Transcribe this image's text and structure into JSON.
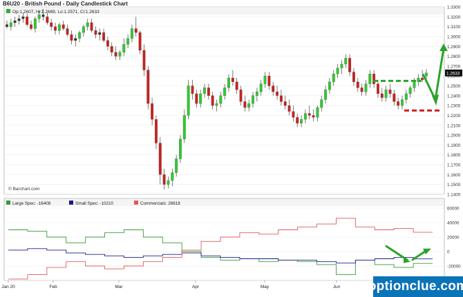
{
  "title": "B6U20 - British Pound - Daily Candlestick Chart",
  "ohlc_label": "Op:1.2607, Hi:1.2669, Lo:1.2571, Cl:1.2633",
  "last_price": "1.2633",
  "copyright": "© Barchart.com",
  "brand": "optionclue.com",
  "colors": {
    "up": "#2ecc2e",
    "down": "#cc1f1f",
    "large_spec": "#3a9a3a",
    "small_spec": "#1a1a8c",
    "commercials": "#e25a5a",
    "annotation_green": "#29a329",
    "annotation_red": "#cc2020"
  },
  "chart_data": [
    {
      "type": "candlestick",
      "title": "B6U20 - British Pound - Daily Candlestick Chart",
      "ylim": [
        1.14,
        1.33
      ],
      "yticks": [
        1.14,
        1.15,
        1.16,
        1.17,
        1.18,
        1.19,
        1.2,
        1.21,
        1.22,
        1.23,
        1.24,
        1.25,
        1.26,
        1.27,
        1.28,
        1.29,
        1.3,
        1.31,
        1.32,
        1.33
      ],
      "x_labels": [
        "Jan 20",
        "Feb",
        "Mar",
        "Apr",
        "May",
        "Jun"
      ],
      "candles": [
        [
          1.312,
          1.316,
          1.308,
          1.31
        ],
        [
          1.31,
          1.318,
          1.306,
          1.314
        ],
        [
          1.314,
          1.32,
          1.31,
          1.316
        ],
        [
          1.316,
          1.322,
          1.312,
          1.318
        ],
        [
          1.318,
          1.324,
          1.314,
          1.32
        ],
        [
          1.32,
          1.323,
          1.31,
          1.312
        ],
        [
          1.312,
          1.316,
          1.306,
          1.308
        ],
        [
          1.308,
          1.32,
          1.304,
          1.318
        ],
        [
          1.318,
          1.326,
          1.314,
          1.322
        ],
        [
          1.322,
          1.328,
          1.316,
          1.32
        ],
        [
          1.32,
          1.324,
          1.312,
          1.314
        ],
        [
          1.314,
          1.318,
          1.306,
          1.31
        ],
        [
          1.31,
          1.314,
          1.302,
          1.306
        ],
        [
          1.306,
          1.314,
          1.302,
          1.312
        ],
        [
          1.312,
          1.316,
          1.306,
          1.308
        ],
        [
          1.308,
          1.312,
          1.3,
          1.302
        ],
        [
          1.302,
          1.306,
          1.292,
          1.296
        ],
        [
          1.296,
          1.302,
          1.29,
          1.298
        ],
        [
          1.298,
          1.306,
          1.294,
          1.304
        ],
        [
          1.304,
          1.312,
          1.3,
          1.31
        ],
        [
          1.31,
          1.318,
          1.306,
          1.314
        ],
        [
          1.314,
          1.318,
          1.304,
          1.306
        ],
        [
          1.306,
          1.31,
          1.298,
          1.302
        ],
        [
          1.302,
          1.308,
          1.296,
          1.304
        ],
        [
          1.304,
          1.308,
          1.294,
          1.296
        ],
        [
          1.296,
          1.3,
          1.286,
          1.29
        ],
        [
          1.29,
          1.294,
          1.28,
          1.284
        ],
        [
          1.284,
          1.29,
          1.276,
          1.28
        ],
        [
          1.28,
          1.286,
          1.276,
          1.284
        ],
        [
          1.284,
          1.298,
          1.28,
          1.292
        ],
        [
          1.292,
          1.302,
          1.288,
          1.298
        ],
        [
          1.298,
          1.312,
          1.294,
          1.308
        ],
        [
          1.308,
          1.32,
          1.3,
          1.304
        ],
        [
          1.304,
          1.306,
          1.282,
          1.286
        ],
        [
          1.286,
          1.292,
          1.26,
          1.266
        ],
        [
          1.266,
          1.27,
          1.226,
          1.232
        ],
        [
          1.232,
          1.238,
          1.21,
          1.216
        ],
        [
          1.216,
          1.22,
          1.186,
          1.192
        ],
        [
          1.192,
          1.198,
          1.15,
          1.16
        ],
        [
          1.16,
          1.166,
          1.145,
          1.15
        ],
        [
          1.15,
          1.158,
          1.146,
          1.154
        ],
        [
          1.154,
          1.166,
          1.148,
          1.162
        ],
        [
          1.162,
          1.18,
          1.158,
          1.176
        ],
        [
          1.176,
          1.2,
          1.172,
          1.196
        ],
        [
          1.196,
          1.226,
          1.192,
          1.22
        ],
        [
          1.22,
          1.256,
          1.216,
          1.25
        ],
        [
          1.25,
          1.256,
          1.236,
          1.242
        ],
        [
          1.242,
          1.246,
          1.228,
          1.232
        ],
        [
          1.232,
          1.246,
          1.228,
          1.242
        ],
        [
          1.242,
          1.252,
          1.238,
          1.248
        ],
        [
          1.248,
          1.252,
          1.236,
          1.24
        ],
        [
          1.24,
          1.244,
          1.226,
          1.23
        ],
        [
          1.23,
          1.236,
          1.224,
          1.232
        ],
        [
          1.232,
          1.244,
          1.228,
          1.24
        ],
        [
          1.24,
          1.252,
          1.236,
          1.248
        ],
        [
          1.248,
          1.262,
          1.244,
          1.258
        ],
        [
          1.258,
          1.266,
          1.25,
          1.254
        ],
        [
          1.254,
          1.258,
          1.242,
          1.246
        ],
        [
          1.246,
          1.25,
          1.23,
          1.234
        ],
        [
          1.234,
          1.24,
          1.224,
          1.228
        ],
        [
          1.228,
          1.236,
          1.224,
          1.232
        ],
        [
          1.232,
          1.244,
          1.228,
          1.24
        ],
        [
          1.24,
          1.248,
          1.234,
          1.244
        ],
        [
          1.244,
          1.256,
          1.24,
          1.252
        ],
        [
          1.252,
          1.264,
          1.248,
          1.26
        ],
        [
          1.26,
          1.264,
          1.246,
          1.25
        ],
        [
          1.25,
          1.254,
          1.24,
          1.244
        ],
        [
          1.244,
          1.25,
          1.236,
          1.24
        ],
        [
          1.24,
          1.246,
          1.23,
          1.234
        ],
        [
          1.234,
          1.24,
          1.226,
          1.23
        ],
        [
          1.23,
          1.236,
          1.22,
          1.224
        ],
        [
          1.224,
          1.23,
          1.214,
          1.218
        ],
        [
          1.218,
          1.222,
          1.208,
          1.212
        ],
        [
          1.212,
          1.22,
          1.208,
          1.216
        ],
        [
          1.216,
          1.226,
          1.212,
          1.222
        ],
        [
          1.222,
          1.23,
          1.216,
          1.22
        ],
        [
          1.22,
          1.226,
          1.214,
          1.218
        ],
        [
          1.218,
          1.23,
          1.214,
          1.228
        ],
        [
          1.228,
          1.24,
          1.224,
          1.236
        ],
        [
          1.236,
          1.25,
          1.232,
          1.246
        ],
        [
          1.246,
          1.258,
          1.242,
          1.254
        ],
        [
          1.254,
          1.266,
          1.25,
          1.262
        ],
        [
          1.262,
          1.272,
          1.258,
          1.268
        ],
        [
          1.268,
          1.276,
          1.262,
          1.272
        ],
        [
          1.272,
          1.282,
          1.268,
          1.278
        ],
        [
          1.278,
          1.282,
          1.26,
          1.264
        ],
        [
          1.264,
          1.268,
          1.25,
          1.254
        ],
        [
          1.254,
          1.258,
          1.244,
          1.248
        ],
        [
          1.248,
          1.252,
          1.24,
          1.244
        ],
        [
          1.244,
          1.256,
          1.24,
          1.252
        ],
        [
          1.252,
          1.266,
          1.248,
          1.262
        ],
        [
          1.262,
          1.266,
          1.248,
          1.252
        ],
        [
          1.252,
          1.256,
          1.238,
          1.242
        ],
        [
          1.242,
          1.248,
          1.234,
          1.238
        ],
        [
          1.238,
          1.25,
          1.234,
          1.246
        ],
        [
          1.246,
          1.252,
          1.238,
          1.242
        ],
        [
          1.242,
          1.246,
          1.23,
          1.234
        ],
        [
          1.234,
          1.238,
          1.226,
          1.23
        ],
        [
          1.23,
          1.24,
          1.226,
          1.236
        ],
        [
          1.236,
          1.246,
          1.232,
          1.242
        ],
        [
          1.242,
          1.25,
          1.238,
          1.248
        ],
        [
          1.248,
          1.258,
          1.244,
          1.254
        ],
        [
          1.254,
          1.262,
          1.25,
          1.258
        ],
        [
          1.258,
          1.266,
          1.254,
          1.256
        ],
        [
          1.26,
          1.267,
          1.257,
          1.263
        ]
      ]
    },
    {
      "type": "line",
      "title": "Commitment of Traders",
      "ylim": [
        -40000,
        60000
      ],
      "yticks": [
        -40000,
        -20000,
        0,
        20000,
        40000,
        60000
      ],
      "legend": [
        "Large Spec: -16408",
        "Small Spec: -10210",
        "Commercials: 26618"
      ],
      "series": [
        {
          "name": "Large Spec",
          "values": [
            30000,
            28000,
            20000,
            12000,
            20000,
            26000,
            30000,
            20000,
            12000,
            0,
            -8000,
            -12000,
            -10000,
            -14000,
            -12000,
            -14000,
            -18000,
            -32000,
            -12000,
            -18000,
            -22000,
            -16408
          ]
        },
        {
          "name": "Small Spec",
          "values": [
            2000,
            4000,
            2000,
            -2000,
            -4000,
            -6000,
            -8000,
            -6000,
            -4000,
            -2000,
            -6000,
            -8000,
            -10000,
            -10000,
            -12000,
            -12000,
            -14000,
            -16000,
            -12000,
            -10000,
            -8000,
            -10210
          ]
        },
        {
          "name": "Commercials",
          "values": [
            -38000,
            -32000,
            -22000,
            -14000,
            -20000,
            -24000,
            -20000,
            -14000,
            -8000,
            2000,
            14000,
            20000,
            26000,
            24000,
            30000,
            34000,
            38000,
            46000,
            34000,
            30000,
            32000,
            26618
          ]
        }
      ]
    }
  ]
}
